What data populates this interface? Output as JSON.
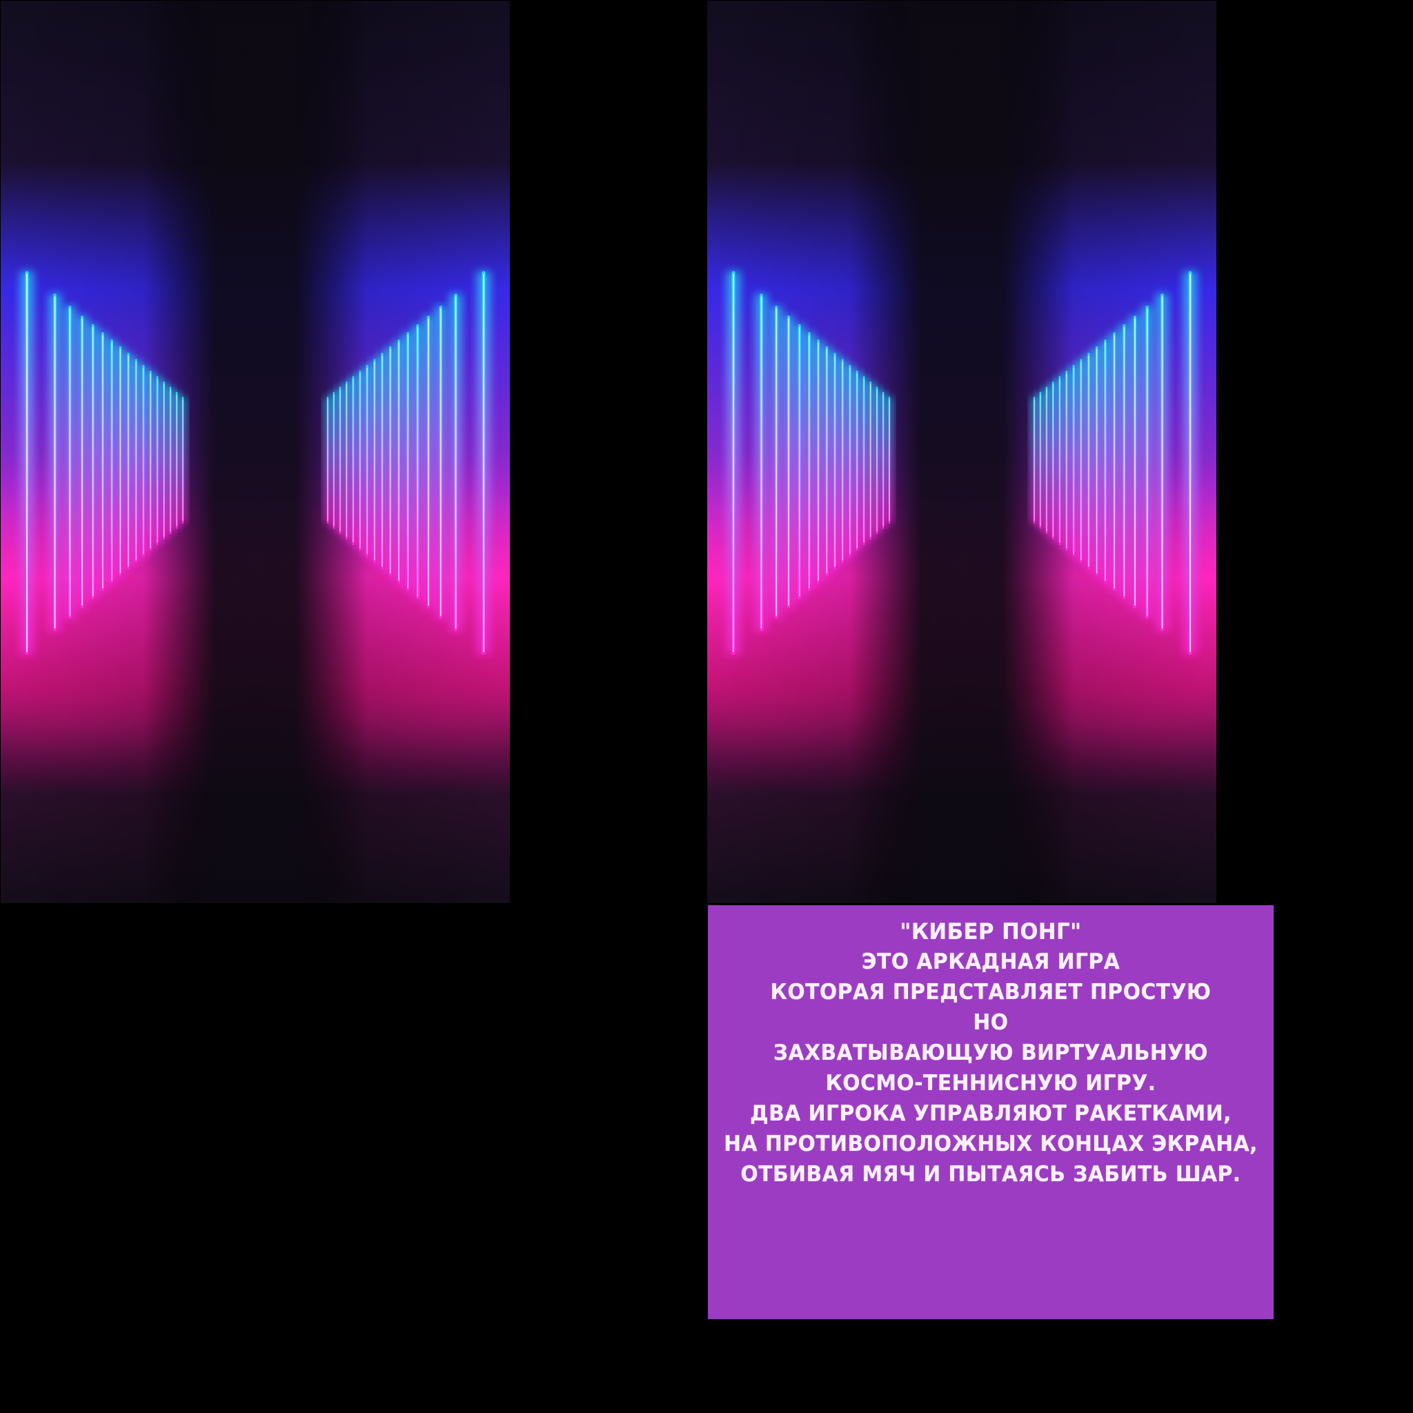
{
  "scene": {
    "background_color": "#000000",
    "art": "neon-corridor",
    "neon_colors": [
      "#23d9ff",
      "#3b2cff",
      "#ff2ad9",
      "#ff1f8f"
    ],
    "panel_color": "#9b3cc3",
    "panel_text_color": "#fff2fc"
  },
  "info": {
    "lines": [
      "\"КИБЕР ПОНГ\"",
      "ЭТО АРКАДНАЯ ИГРА",
      "КОТОРАЯ ПРЕДСТАВЛЯЕТ ПРОСТУЮ",
      "НО",
      "ЗАХВАТЫВАЮЩУЮ ВИРТУАЛЬНУЮ",
      "КОСМО-ТЕННИСНУЮ ИГРУ.",
      "ДВА ИГРОКА УПРАВЛЯЮТ РАКЕТКАМИ,",
      "НА ПРОТИВОПОЛОЖНЫХ КОНЦАХ ЭКРАНА,",
      "ОТБИВАЯ МЯЧ И ПЫТАЯСЬ ЗАБИТЬ ШАР."
    ]
  }
}
